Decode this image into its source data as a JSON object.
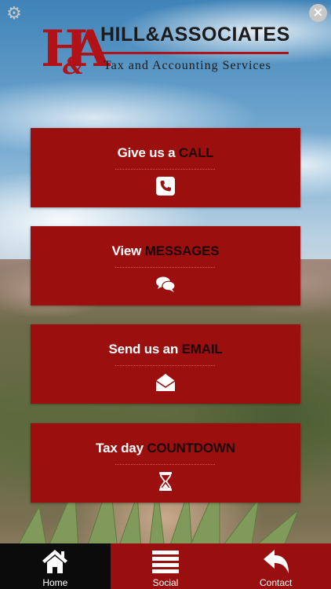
{
  "brand": {
    "monogram": "HA",
    "monogram_amp": "&",
    "firm_name": "HILL&ASSOCIATES",
    "tagline": "Tax and Accounting Services",
    "accent_color": "#b01217"
  },
  "top_controls": {
    "settings_icon": "gear-icon",
    "close_icon": "close-icon"
  },
  "cards": [
    {
      "prefix": "Give us a ",
      "accent": "CALL",
      "icon": "phone-icon"
    },
    {
      "prefix": "View ",
      "accent": "MESSAGES",
      "icon": "chat-bubbles-icon"
    },
    {
      "prefix": "Send us an ",
      "accent": "EMAIL",
      "icon": "envelope-icon"
    },
    {
      "prefix": "Tax day ",
      "accent": "COUNTDOWN",
      "icon": "hourglass-icon"
    }
  ],
  "card_color": "#9b0f0f",
  "tabs": [
    {
      "label": "Home",
      "icon": "home-icon",
      "active": true
    },
    {
      "label": "Social",
      "icon": "menu-lines-icon",
      "active": false
    },
    {
      "label": "Contact",
      "icon": "reply-arrow-icon",
      "active": false
    }
  ]
}
